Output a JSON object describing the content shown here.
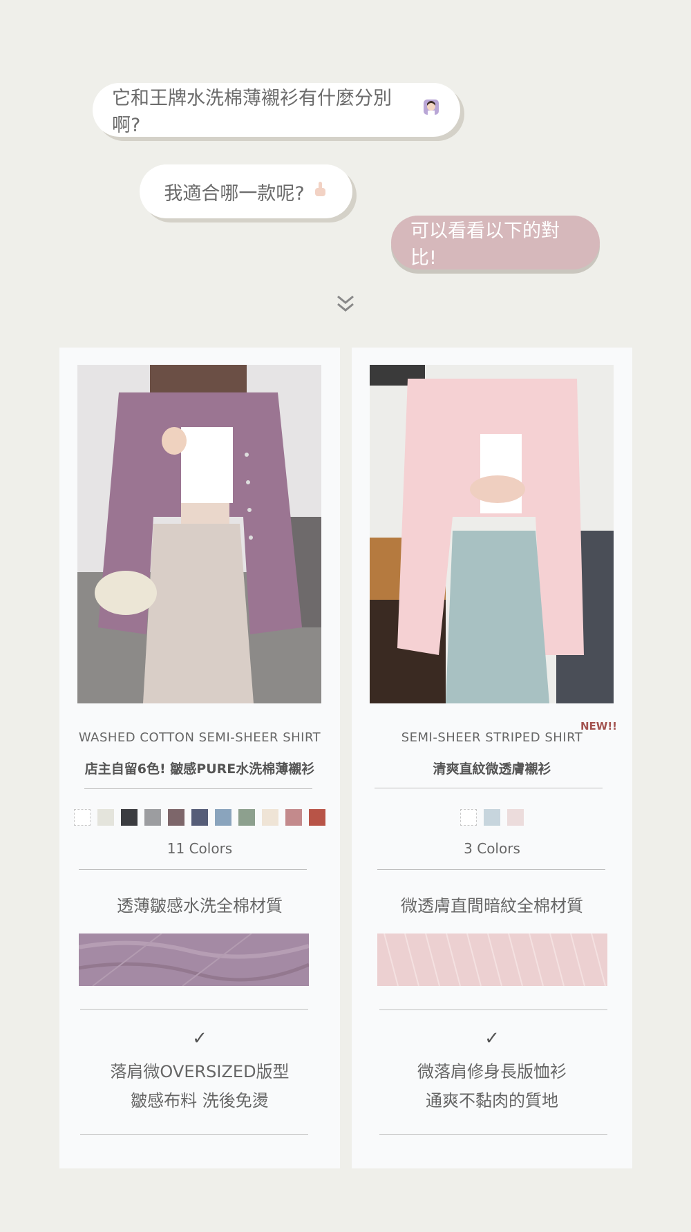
{
  "chat": {
    "bubble1": "它和王牌水洗棉薄襯衫有什麼分別啊?",
    "bubble2": "我適合哪一款呢?",
    "bubble3": "可以看看以下的對比!",
    "bubble1_icon": "woman-tipping-hand-emoji",
    "bubble2_icon": "pointing-up-emoji"
  },
  "scroll_hint_icon": "double-chevron-down-icon",
  "products": [
    {
      "en_name": "WASHED COTTON SEMI-SHEER SHIRT",
      "zh_name": "店主自留6色! 皺感PURE水洗棉薄襯衫",
      "colors_label": "11 Colors",
      "swatches": [
        "#ffffff",
        "#e4e4dc",
        "#3b3c40",
        "#9c9da0",
        "#7d666a",
        "#565d78",
        "#8aa4bd",
        "#8da08e",
        "#efe4d6",
        "#c38a8c",
        "#b85447"
      ],
      "material": "透薄皺感水洗全棉材質",
      "check": "✓",
      "feature_line1": "落肩微OVERSIZED版型",
      "feature_line2": "皺感布料 洗後免燙"
    },
    {
      "badge": "NEW!!",
      "en_name": "SEMI-SHEER STRIPED SHIRT",
      "zh_name": "清爽直紋微透膚襯衫",
      "colors_label": "3 Colors",
      "swatches": [
        "#ffffff",
        "#c7d5dd",
        "#ecdcdc"
      ],
      "material": "微透膚直間暗紋全棉材質",
      "check": "✓",
      "feature_line1": "微落肩修身長版恤衫",
      "feature_line2": "通爽不黏肉的質地"
    }
  ]
}
